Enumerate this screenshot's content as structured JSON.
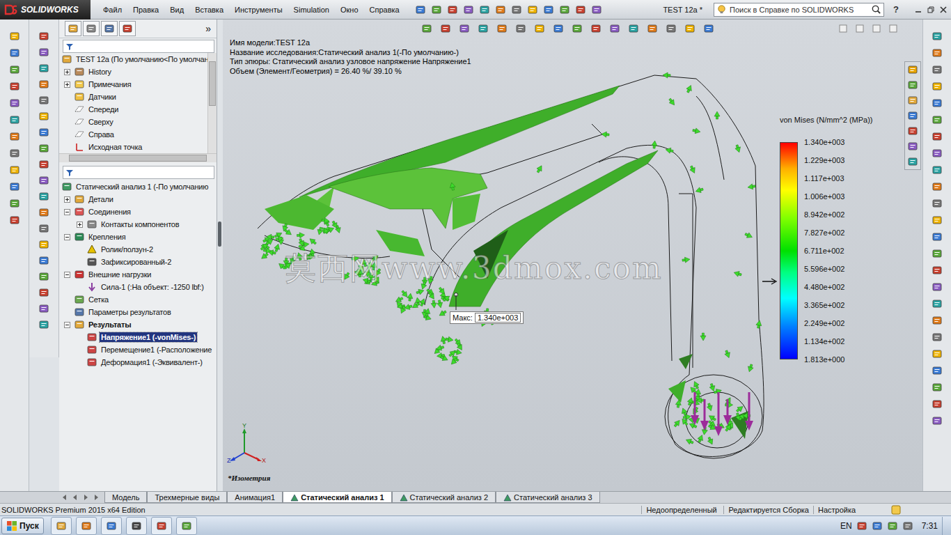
{
  "app": {
    "name": "SOLIDWORKS"
  },
  "menu": [
    "Файл",
    "Правка",
    "Вид",
    "Вставка",
    "Инструменты",
    "Simulation",
    "Окно",
    "Справка"
  ],
  "document_title": "TEST 12a *",
  "search": {
    "placeholder": "Поиск в Справке по SOLIDWORKS"
  },
  "help": "?",
  "feature_manager": {
    "more": "»",
    "tree": [
      {
        "label": "TEST 12a  (По умолчанию<По умолчан",
        "level": 0,
        "kind": "assembly",
        "expandable": false,
        "expanded": false,
        "selected": false,
        "bold": false
      },
      {
        "label": "History",
        "level": 1,
        "kind": "history",
        "expandable": true,
        "expanded": false,
        "selected": false,
        "bold": false
      },
      {
        "label": "Примечания",
        "level": 1,
        "kind": "notes",
        "expandable": true,
        "expanded": false,
        "selected": false,
        "bold": false
      },
      {
        "label": "Датчики",
        "level": 1,
        "kind": "sensors",
        "expandable": false,
        "expanded": false,
        "selected": false,
        "bold": false
      },
      {
        "label": "Спереди",
        "level": 1,
        "kind": "plane",
        "expandable": false,
        "expanded": false,
        "selected": false,
        "bold": false
      },
      {
        "label": "Сверху",
        "level": 1,
        "kind": "plane",
        "expandable": false,
        "expanded": false,
        "selected": false,
        "bold": false
      },
      {
        "label": "Справа",
        "level": 1,
        "kind": "plane",
        "expandable": false,
        "expanded": false,
        "selected": false,
        "bold": false
      },
      {
        "label": "Исходная точка",
        "level": 1,
        "kind": "origin",
        "expandable": false,
        "expanded": false,
        "selected": false,
        "bold": false
      }
    ],
    "study_tree": [
      {
        "label": "Статический анализ 1 (-По умолчанию",
        "level": 0,
        "kind": "study",
        "expandable": false,
        "expanded": true,
        "selected": false,
        "bold": false
      },
      {
        "label": "Детали",
        "level": 1,
        "kind": "parts",
        "expandable": true,
        "expanded": false,
        "selected": false,
        "bold": false
      },
      {
        "label": "Соединения",
        "level": 1,
        "kind": "connections",
        "expandable": true,
        "expanded": true,
        "selected": false,
        "bold": false
      },
      {
        "label": "Контакты компонентов",
        "level": 2,
        "kind": "contacts",
        "expandable": true,
        "expanded": false,
        "selected": false,
        "bold": false
      },
      {
        "label": "Крепления",
        "level": 1,
        "kind": "fixtures",
        "expandable": true,
        "expanded": true,
        "selected": false,
        "bold": false
      },
      {
        "label": "Ролик/ползун-2",
        "level": 2,
        "kind": "roller",
        "expandable": false,
        "expanded": false,
        "selected": false,
        "bold": false
      },
      {
        "label": "Зафиксированный-2",
        "level": 2,
        "kind": "fixed",
        "expandable": false,
        "expanded": false,
        "selected": false,
        "bold": false
      },
      {
        "label": "Внешние нагрузки",
        "level": 1,
        "kind": "loads",
        "expandable": true,
        "expanded": true,
        "selected": false,
        "bold": false
      },
      {
        "label": "Сила-1 (:На объект: -1250 lbf:)",
        "level": 2,
        "kind": "force",
        "expandable": false,
        "expanded": false,
        "selected": false,
        "bold": false
      },
      {
        "label": "Сетка",
        "level": 1,
        "kind": "mesh",
        "expandable": false,
        "expanded": false,
        "selected": false,
        "bold": false
      },
      {
        "label": "Параметры результатов",
        "level": 1,
        "kind": "options",
        "expandable": false,
        "expanded": false,
        "selected": false,
        "bold": false
      },
      {
        "label": "Результаты",
        "level": 1,
        "kind": "results",
        "expandable": true,
        "expanded": true,
        "selected": false,
        "bold": true
      },
      {
        "label": "Напряжение1 (-vonMises-)",
        "level": 2,
        "kind": "stress",
        "expandable": false,
        "expanded": false,
        "selected": true,
        "bold": true
      },
      {
        "label": "Перемещение1 (-Расположение",
        "level": 2,
        "kind": "displacement",
        "expandable": false,
        "expanded": false,
        "selected": false,
        "bold": false
      },
      {
        "label": "Деформация1 (-Эквивалент-)",
        "level": 2,
        "kind": "strain",
        "expandable": false,
        "expanded": false,
        "selected": false,
        "bold": false
      }
    ]
  },
  "viewport": {
    "info": [
      "Имя модели:TEST 12a",
      "Название исследования:Статический анализ 1(-По умолчанию-)",
      "Тип эпюры: Статический анализ узловое напряжение Напряжение1",
      "Объем (Элемент/Геометрия) = 26.40 %/ 39.10 %"
    ],
    "max_label": "Макс:",
    "max_value": "1.340e+003",
    "view_name": "*Изометрия",
    "watermark": "莫西网www.3dmox.com",
    "axes": {
      "x": "X",
      "y": "Y",
      "z": "Z"
    }
  },
  "legend": {
    "title": "von Mises (N/mm^2 (MPa))",
    "values": [
      "1.340e+003",
      "1.229e+003",
      "1.117e+003",
      "1.006e+003",
      "8.942e+002",
      "7.827e+002",
      "6.711e+002",
      "5.596e+002",
      "4.480e+002",
      "3.365e+002",
      "2.249e+002",
      "1.134e+002",
      "1.813e+000"
    ],
    "marker_level": 0.36
  },
  "tabs": [
    {
      "label": "Модель",
      "selected": false,
      "kind": "plain"
    },
    {
      "label": "Трехмерные виды",
      "selected": false,
      "kind": "plain"
    },
    {
      "label": "Анимация1",
      "selected": false,
      "kind": "plain"
    },
    {
      "label": "Статический анализ 1",
      "selected": true,
      "kind": "study"
    },
    {
      "label": "Статический анализ 2",
      "selected": false,
      "kind": "study"
    },
    {
      "label": "Статический анализ 3",
      "selected": false,
      "kind": "study"
    }
  ],
  "status_bar": {
    "product": "SOLIDWORKS Premium 2015 x64 Edition",
    "cells": [
      "Недоопределенный",
      "Редактируется Сборка",
      "Настройка"
    ]
  },
  "taskbar": {
    "start": "Пуск",
    "language": "EN",
    "time": "7:31"
  }
}
